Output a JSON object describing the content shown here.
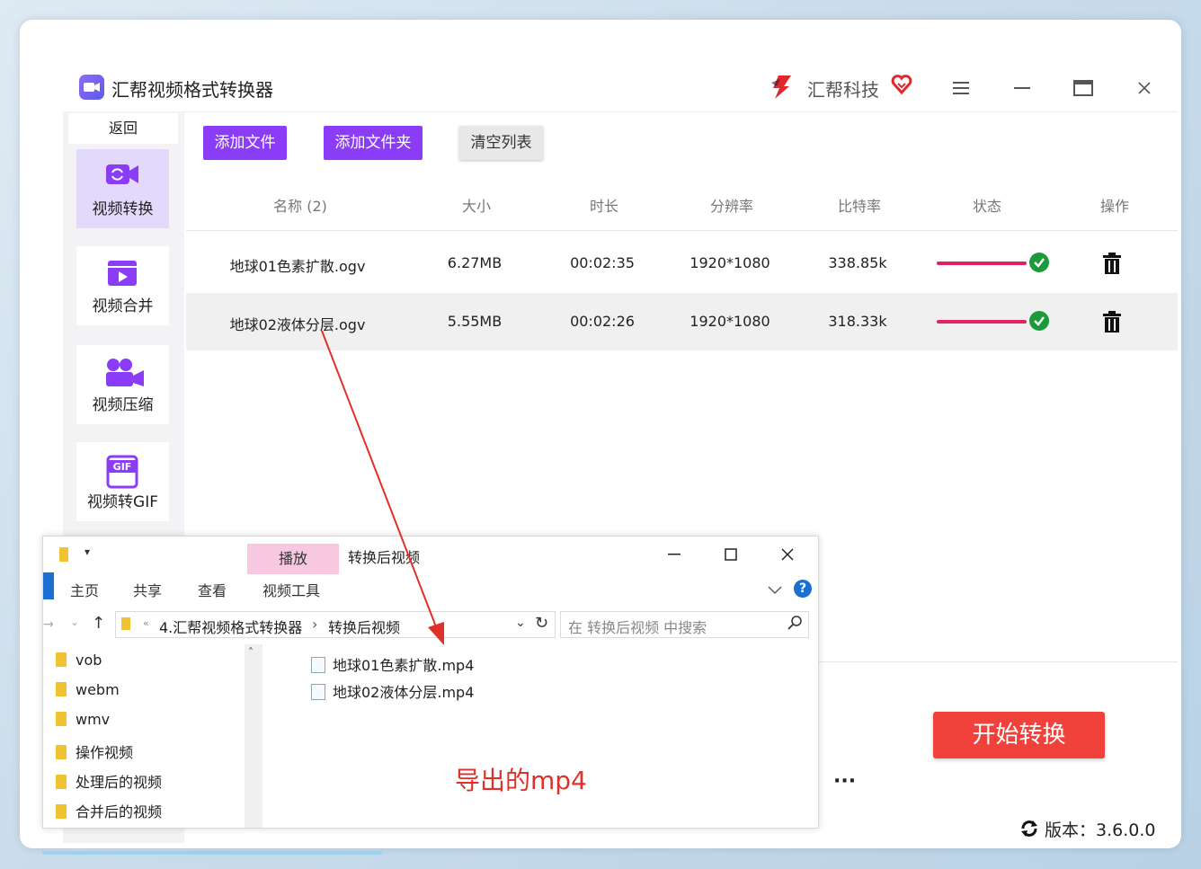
{
  "app": {
    "title": "汇帮视频格式转换器",
    "brand": "汇帮科技",
    "back_label": "返回",
    "version_label": "版本：3.6.0.0"
  },
  "sidebar": {
    "items": [
      {
        "label": "视频转换",
        "icon": "video-convert-icon",
        "active": true
      },
      {
        "label": "视频合并",
        "icon": "video-merge-icon",
        "active": false
      },
      {
        "label": "视频压缩",
        "icon": "video-compress-icon",
        "active": false
      },
      {
        "label": "视频转GIF",
        "icon": "gif-icon",
        "active": false
      }
    ]
  },
  "toolbar": {
    "add_file": "添加文件",
    "add_folder": "添加文件夹",
    "clear_list": "清空列表"
  },
  "table": {
    "headers": [
      "名称 (2)",
      "大小",
      "时长",
      "分辨率",
      "比特率",
      "状态",
      "操作"
    ],
    "rows": [
      {
        "name": "地球01色素扩散.ogv",
        "size": "6.27MB",
        "duration": "00:02:35",
        "resolution": "1920*1080",
        "bitrate": "338.85k",
        "progress": 1.0
      },
      {
        "name": "地球02液体分层.ogv",
        "size": "5.55MB",
        "duration": "00:02:26",
        "resolution": "1920*1080",
        "bitrate": "318.33k",
        "progress": 1.0
      }
    ]
  },
  "start_button": "开始转换",
  "explorer": {
    "play_tab": "播放",
    "title": "转换后视频",
    "tabs": [
      "主页",
      "共享",
      "查看",
      "视频工具"
    ],
    "address": [
      "4.汇帮视频格式转换器",
      "转换后视频"
    ],
    "search_placeholder": "在 转换后视频 中搜索",
    "tree": [
      "vob",
      "webm",
      "wmv",
      "操作视频",
      "处理后的视频",
      "合并后的视频"
    ],
    "files": [
      "地球01色素扩散.mp4",
      "地球02液体分层.mp4"
    ]
  },
  "annotation": "导出的mp4",
  "colors": {
    "accent_purple": "#8b3cf7",
    "start_red": "#f0413a",
    "progress_red": "#e0245e",
    "success_green": "#1a9a3a"
  }
}
